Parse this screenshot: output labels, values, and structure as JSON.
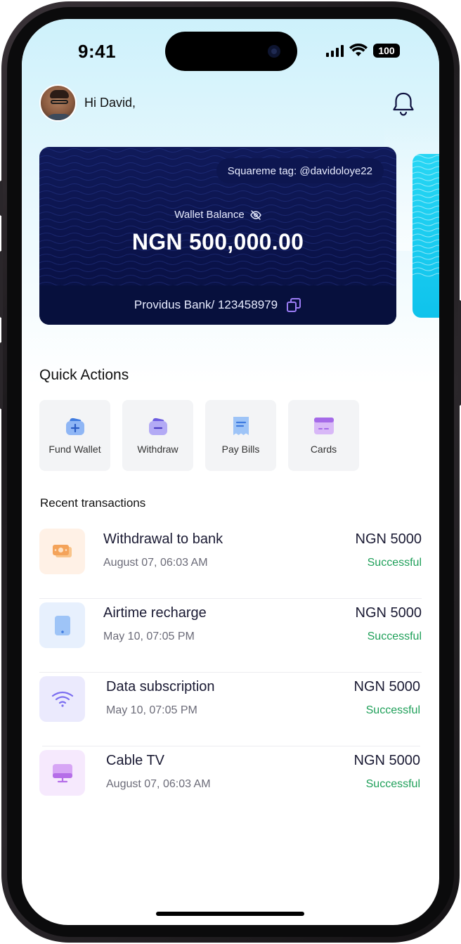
{
  "status_bar": {
    "time": "9:41",
    "battery": "100"
  },
  "header": {
    "greeting": "Hi David,"
  },
  "wallet_card": {
    "tag": "Squareme tag: @davidoloye22",
    "balance_label": "Wallet Balance",
    "balance_value": "NGN 500,000.00",
    "bank_info": "Providus Bank/  123458979"
  },
  "quick_actions": {
    "title": "Quick Actions",
    "items": [
      {
        "label": "Fund Wallet",
        "icon": "fund-wallet-icon"
      },
      {
        "label": "Withdraw",
        "icon": "withdraw-icon"
      },
      {
        "label": "Pay Bills",
        "icon": "receipt-icon"
      },
      {
        "label": "Cards",
        "icon": "card-icon"
      }
    ]
  },
  "recent_transactions": {
    "title": "Recent transactions",
    "items": [
      {
        "title": "Withdrawal to bank",
        "date": "August 07, 06:03 AM",
        "amount": "NGN 5000",
        "status": "Successful",
        "icon": "cash-icon"
      },
      {
        "title": "Airtime recharge",
        "date": "May 10, 07:05 PM",
        "amount": "NGN 5000",
        "status": "Successful",
        "icon": "phone-icon"
      },
      {
        "title": "Data subscription",
        "date": "May 10, 07:05 PM",
        "amount": "NGN 5000",
        "status": "Successful",
        "icon": "wifi-icon"
      },
      {
        "title": "Cable TV",
        "date": "August 07, 06:03 AM",
        "amount": "NGN 5000",
        "status": "Successful",
        "icon": "tv-icon"
      }
    ]
  },
  "colors": {
    "card_navy": "#0a1248",
    "accent_cyan": "#0fc3ec",
    "success_green": "#20a05a",
    "copy_icon_purple": "#9b7cf5"
  }
}
